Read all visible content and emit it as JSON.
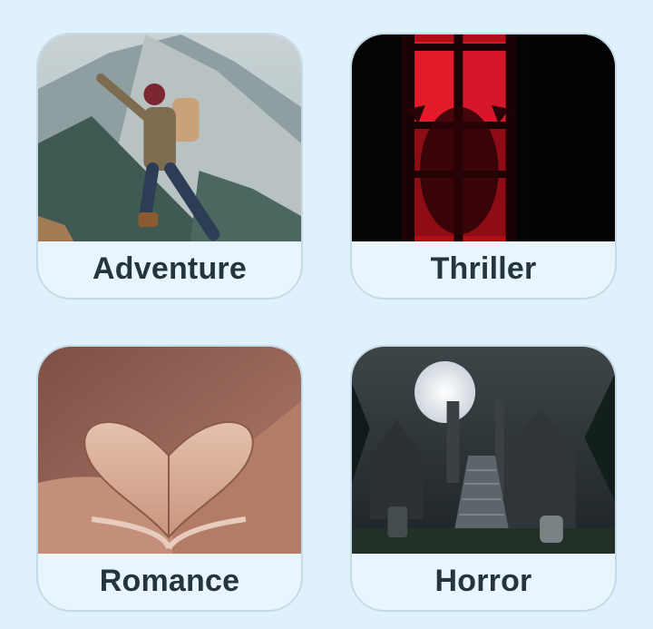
{
  "genres": [
    {
      "label": "Adventure",
      "image": "adventure-hiker-mountain-image"
    },
    {
      "label": "Thriller",
      "image": "thriller-red-window-image"
    },
    {
      "label": "Romance",
      "image": "romance-heart-book-image"
    },
    {
      "label": "Horror",
      "image": "horror-graveyard-moon-image"
    }
  ],
  "colors": {
    "background": "#dff1fb",
    "card": "#e9f5fd",
    "text": "#253540"
  }
}
